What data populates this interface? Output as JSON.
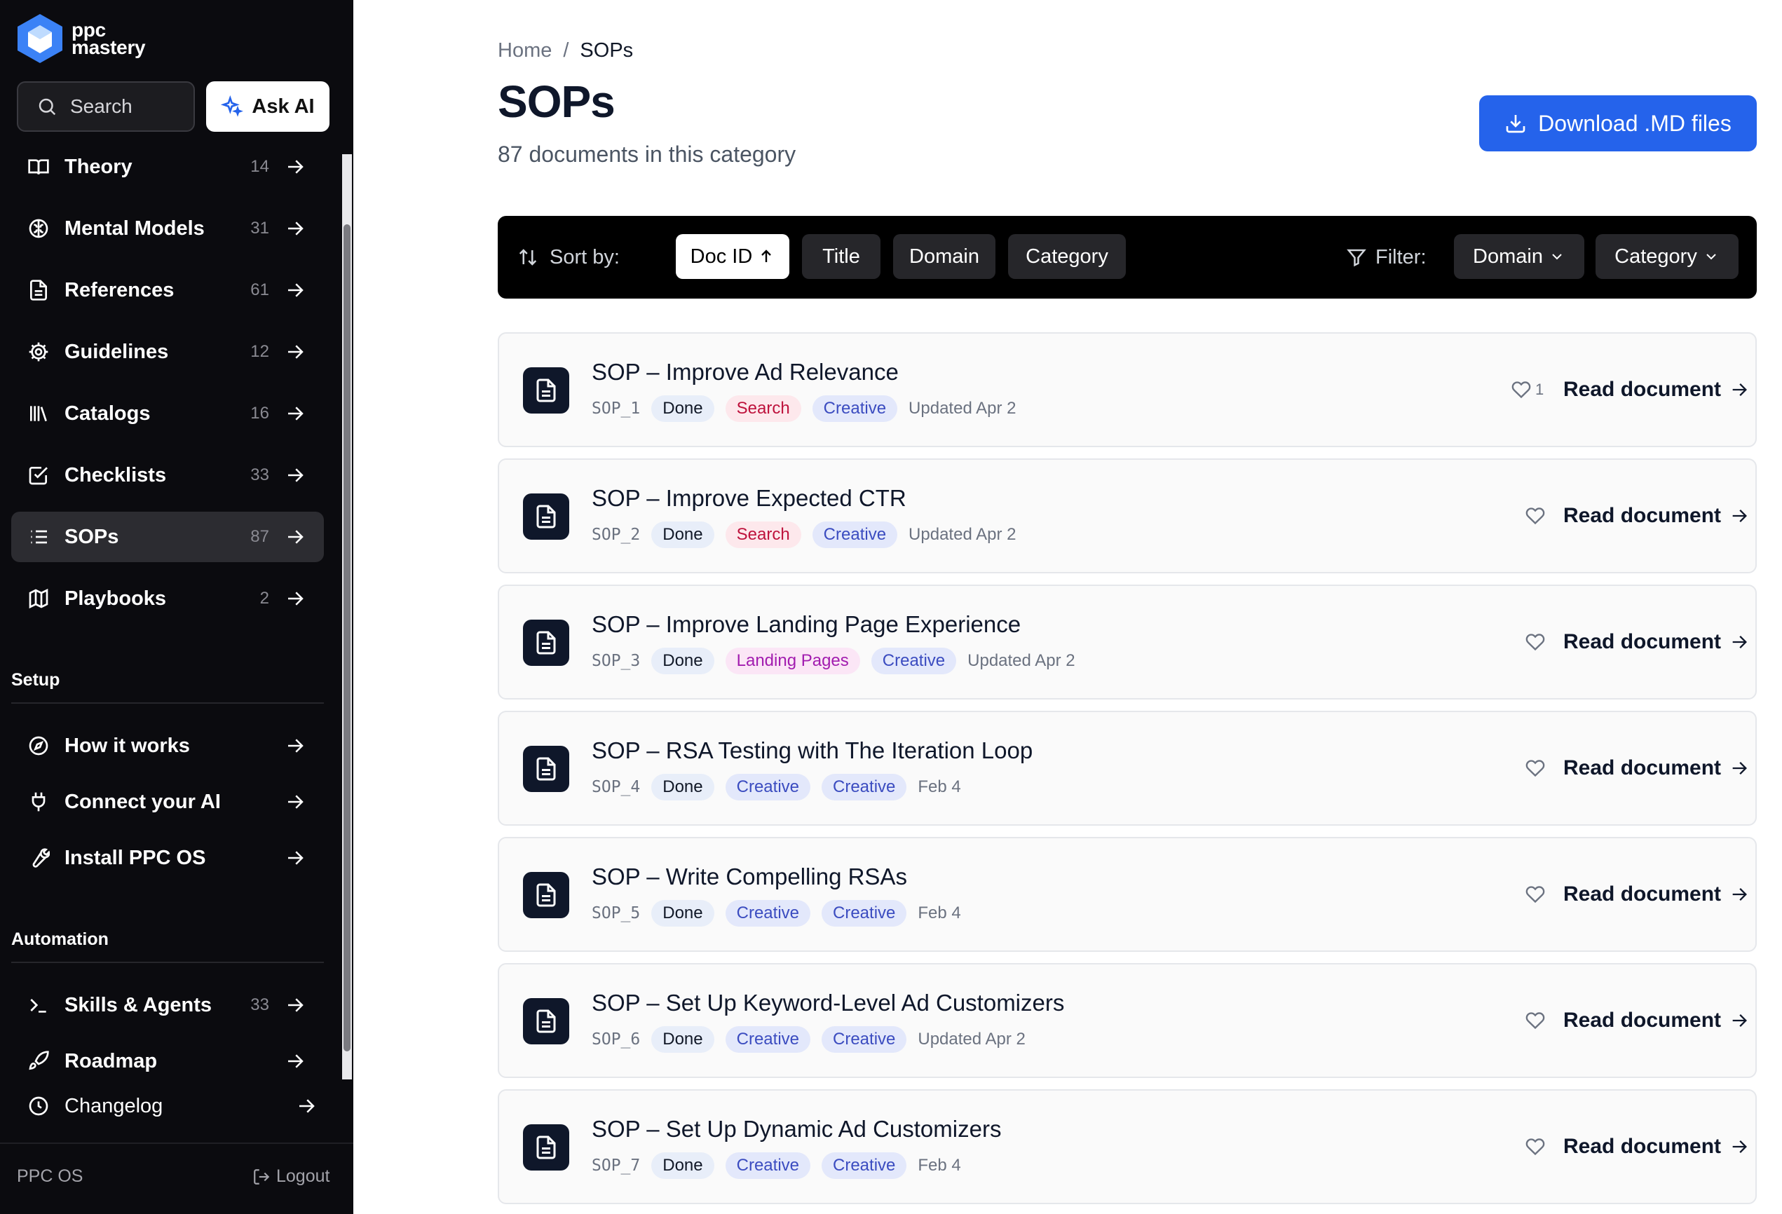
{
  "brand": {
    "line1": "ppc",
    "line2": "mastery",
    "color": "#3b82f6"
  },
  "search": {
    "label": "Search"
  },
  "ask_ai": {
    "label": "Ask AI"
  },
  "nav": [
    {
      "label": "Theory",
      "count": "14",
      "icon": "book-open-icon"
    },
    {
      "label": "Mental Models",
      "count": "31",
      "icon": "brain-icon"
    },
    {
      "label": "References",
      "count": "61",
      "icon": "file-text-icon"
    },
    {
      "label": "Guidelines",
      "count": "12",
      "icon": "gear-icon"
    },
    {
      "label": "Catalogs",
      "count": "16",
      "icon": "library-icon"
    },
    {
      "label": "Checklists",
      "count": "33",
      "icon": "checkbox-icon"
    },
    {
      "label": "SOPs",
      "count": "87",
      "icon": "list-icon",
      "active": true
    },
    {
      "label": "Playbooks",
      "count": "2",
      "icon": "map-icon"
    }
  ],
  "setup": {
    "title": "Setup",
    "items": [
      {
        "label": "How it works",
        "icon": "compass-icon"
      },
      {
        "label": "Connect your AI",
        "icon": "plug-icon"
      },
      {
        "label": "Install PPC OS",
        "icon": "wrench-icon"
      }
    ]
  },
  "automation": {
    "title": "Automation",
    "items": [
      {
        "label": "Skills & Agents",
        "count": "33",
        "icon": "terminal-icon"
      },
      {
        "label": "Roadmap",
        "icon": "rocket-icon"
      },
      {
        "label": "Changelog",
        "icon": "clock-icon"
      }
    ]
  },
  "footer": {
    "left": "PPC OS",
    "logout": "Logout"
  },
  "breadcrumb": {
    "home": "Home",
    "sep": "/",
    "current": "SOPs"
  },
  "page": {
    "title": "SOPs",
    "subtitle": "87 documents in this category"
  },
  "download": {
    "label": "Download .MD files",
    "color": "#2563eb"
  },
  "toolbar": {
    "sort_label": "Sort by:",
    "sort_options": [
      "Doc ID",
      "Title",
      "Domain",
      "Category"
    ],
    "active_sort": "Doc ID",
    "filter_label": "Filter:",
    "filters": [
      "Domain",
      "Category"
    ]
  },
  "documents": [
    {
      "title": "SOP – Improve Ad Relevance",
      "id": "SOP_1",
      "status": "Done",
      "domain": "Search",
      "category": "Creative",
      "updated": "Updated Apr 2",
      "likes": "1"
    },
    {
      "title": "SOP – Improve Expected CTR",
      "id": "SOP_2",
      "status": "Done",
      "domain": "Search",
      "category": "Creative",
      "updated": "Updated Apr 2",
      "likes": ""
    },
    {
      "title": "SOP – Improve Landing Page Experience",
      "id": "SOP_3",
      "status": "Done",
      "domain": "Landing Pages",
      "category": "Creative",
      "updated": "Updated Apr 2",
      "likes": ""
    },
    {
      "title": "SOP – RSA Testing with The Iteration Loop",
      "id": "SOP_4",
      "status": "Done",
      "domain": "Creative",
      "category": "Creative",
      "updated": "Feb 4",
      "likes": ""
    },
    {
      "title": "SOP – Write Compelling RSAs",
      "id": "SOP_5",
      "status": "Done",
      "domain": "Creative",
      "category": "Creative",
      "updated": "Feb 4",
      "likes": ""
    },
    {
      "title": "SOP – Set Up Keyword-Level Ad Customizers",
      "id": "SOP_6",
      "status": "Done",
      "domain": "Creative",
      "category": "Creative",
      "updated": "Updated Apr 2",
      "likes": ""
    },
    {
      "title": "SOP – Set Up Dynamic Ad Customizers",
      "id": "SOP_7",
      "status": "Done",
      "domain": "Creative",
      "category": "Creative",
      "updated": "Feb 4",
      "likes": ""
    }
  ],
  "read_label": "Read document"
}
